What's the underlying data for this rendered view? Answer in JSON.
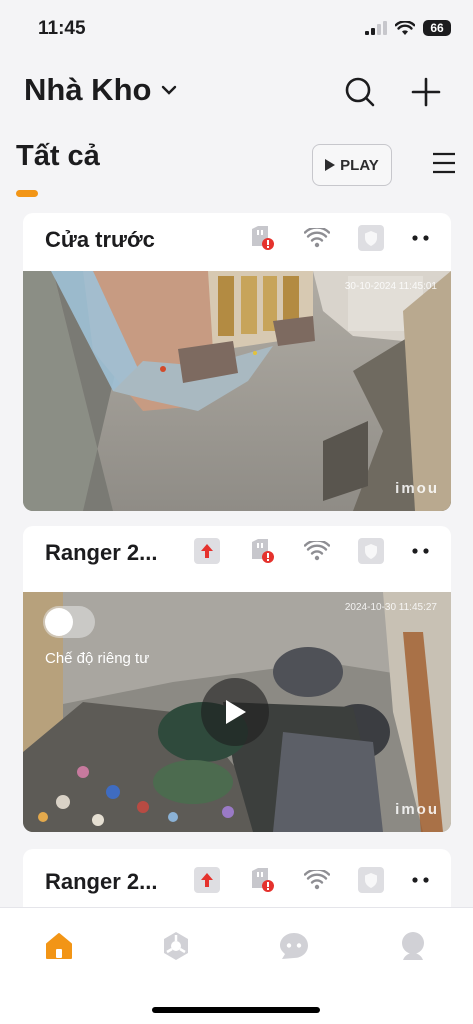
{
  "status_bar": {
    "time": "11:45",
    "battery": "66"
  },
  "header": {
    "title": "Nhà Kho"
  },
  "tabs": {
    "all_label": "Tất cả",
    "play_label": "PLAY"
  },
  "cards": [
    {
      "name": "Cửa trước",
      "timestamp": "30-10-2024 11:45:01",
      "watermark": "imou"
    },
    {
      "name": "Ranger 2...",
      "timestamp": "2024-10-30 11:45:27",
      "watermark": "imou",
      "privacy_label": "Chế độ riêng tư"
    },
    {
      "name": "Ranger 2..."
    }
  ],
  "colors": {
    "accent": "#f29516",
    "alert": "#e5322d"
  }
}
